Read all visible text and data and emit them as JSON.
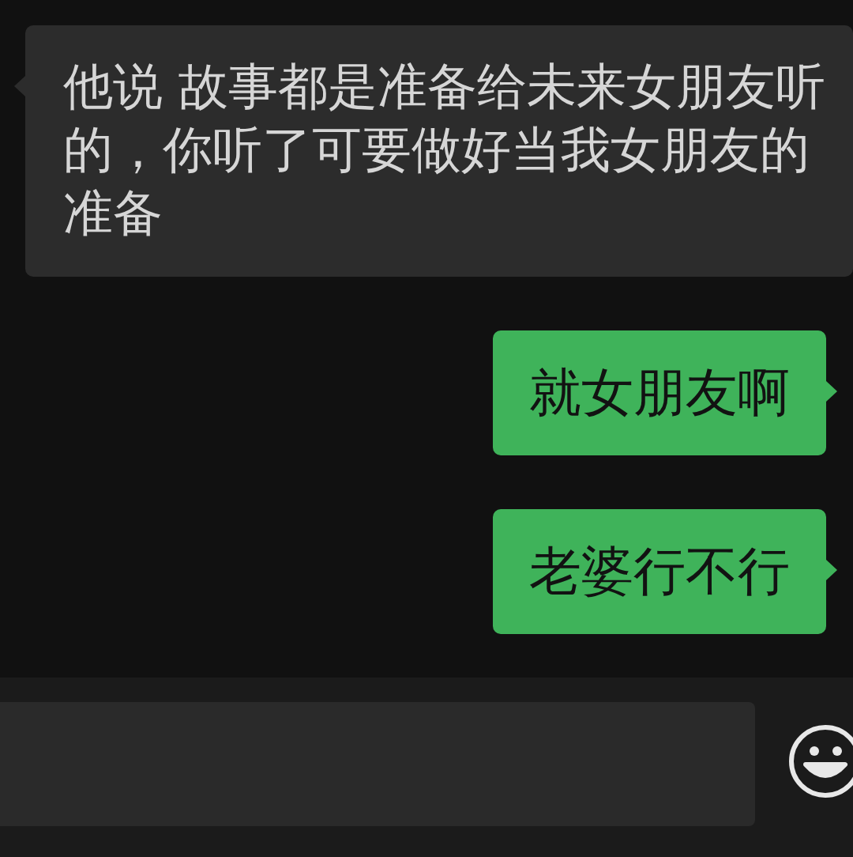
{
  "messages": [
    {
      "kind": "incoming",
      "text": "他说 故事都是准备给未来女朋友听的，你听了可要做好当我女朋友的准备"
    },
    {
      "kind": "outgoing",
      "text": "就女朋友啊"
    },
    {
      "kind": "outgoing",
      "text": "老婆行不行"
    }
  ]
}
